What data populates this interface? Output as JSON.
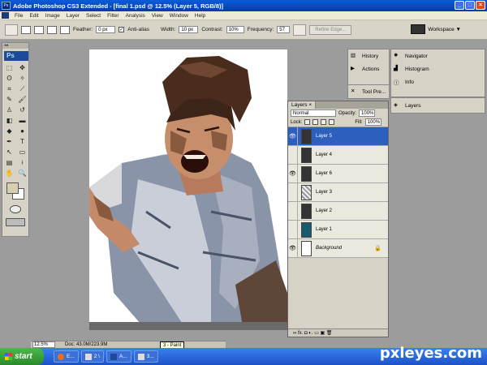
{
  "window": {
    "title": "Adobe Photoshop CS3 Extended - [final 1.psd @ 12.5% (Layer 5, RGB/8)]"
  },
  "menu": [
    "File",
    "Edit",
    "Image",
    "Layer",
    "Select",
    "Filter",
    "Analysis",
    "View",
    "Window",
    "Help"
  ],
  "options": {
    "feather_label": "Feather:",
    "feather_value": "0 px",
    "antialias_label": "Anti-alias",
    "width_label": "Width:",
    "width_value": "10 px",
    "contrast_label": "Contrast:",
    "contrast_value": "10%",
    "frequency_label": "Frequency:",
    "frequency_value": "57",
    "refine_edge": "Refine Edge...",
    "workspace_label": "Workspace ▼"
  },
  "toolbox": {
    "logo": "Ps"
  },
  "panels": {
    "history": "History",
    "actions": "Actions",
    "tool_presets": "Tool Pre...",
    "navigator": "Navigator",
    "histogram": "Histogram",
    "info": "Info",
    "layers_tab": "Layers"
  },
  "layers_panel": {
    "tab": "Layers ×",
    "blend_mode": "Normal",
    "opacity_label": "Opacity:",
    "opacity_value": "100%",
    "lock_label": "Lock:",
    "fill_label": "Fill:",
    "fill_value": "100%",
    "layers": [
      {
        "name": "Layer 5",
        "visible": true,
        "active": true,
        "thumb": "photo"
      },
      {
        "name": "Layer 4",
        "visible": false,
        "active": false,
        "thumb": "photo"
      },
      {
        "name": "Layer 6",
        "visible": true,
        "active": false,
        "thumb": "dark"
      },
      {
        "name": "Layer 3",
        "visible": false,
        "active": false,
        "thumb": "dotted"
      },
      {
        "name": "Layer 2",
        "visible": false,
        "active": false,
        "thumb": "dark"
      },
      {
        "name": "Layer 1",
        "visible": false,
        "active": false,
        "thumb": "teal"
      },
      {
        "name": "Background",
        "visible": true,
        "active": false,
        "thumb": "light",
        "locked": true
      }
    ],
    "bottom_icons": "∞  fx.  ◘  ◐.  ▭  ▣  🗑"
  },
  "status": {
    "zoom": "12.5%",
    "doc": "Doc: 43.0M/223.9M"
  },
  "tooltip": "3 - Paint",
  "taskbar": {
    "start": "start",
    "items": [
      "E...",
      "2 \\",
      "A...",
      "3..."
    ]
  },
  "watermark": "pxleyes.com",
  "colors": {
    "titlebar": "#0a3aa8",
    "taskbar": "#1c52c8",
    "active_layer": "#2d5fbf",
    "foreground": "#d8cfb3"
  }
}
